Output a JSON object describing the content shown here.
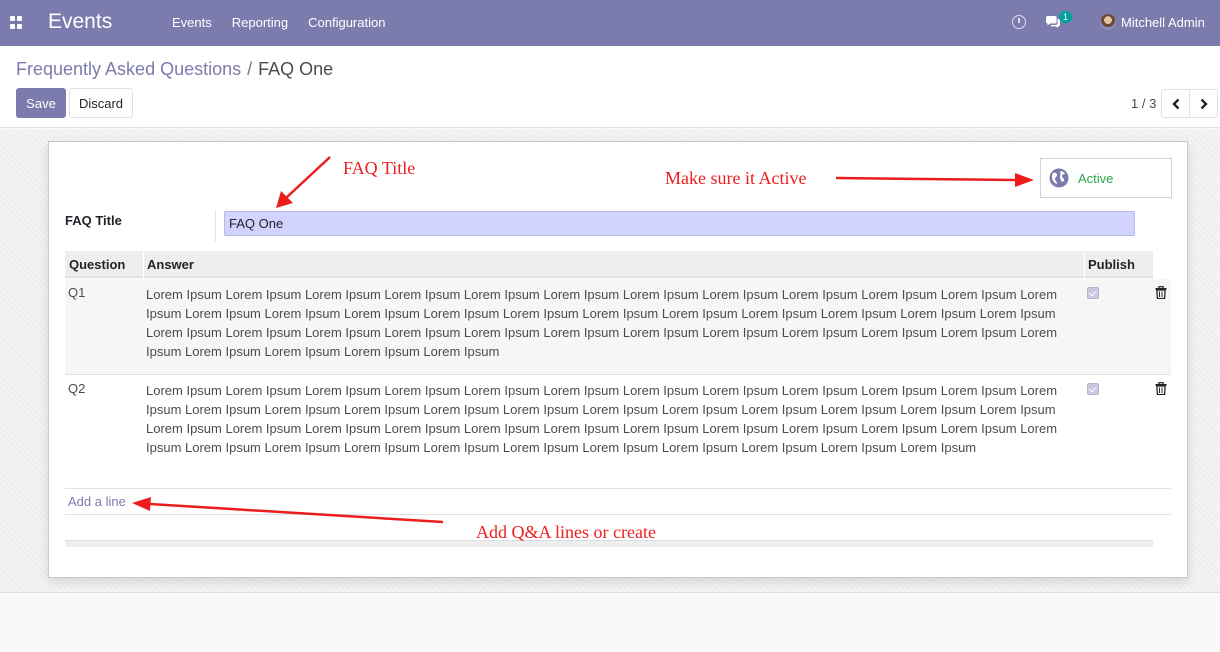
{
  "app": {
    "name": "Events",
    "menu": [
      "Events",
      "Reporting",
      "Configuration"
    ],
    "chat_count": "1",
    "user_name": "Mitchell Admin"
  },
  "breadcrumb": {
    "parent": "Frequently Asked Questions",
    "separator": "/",
    "current": "FAQ One"
  },
  "actions": {
    "save": "Save",
    "discard": "Discard"
  },
  "pager": {
    "value": "1 / 3"
  },
  "form": {
    "status": "Active",
    "title_label": "FAQ Title",
    "title_value": "FAQ One",
    "columns": [
      "Question",
      "Answer",
      "Publish"
    ],
    "rows": [
      {
        "question": "Q1",
        "answer": "Lorem Ipsum Lorem Ipsum Lorem Ipsum Lorem Ipsum Lorem Ipsum Lorem Ipsum Lorem Ipsum Lorem Ipsum Lorem Ipsum Lorem Ipsum Lorem Ipsum Lorem Ipsum Lorem Ipsum Lorem Ipsum Lorem Ipsum Lorem Ipsum Lorem Ipsum Lorem Ipsum Lorem Ipsum Lorem Ipsum Lorem Ipsum Lorem Ipsum Lorem Ipsum Lorem Ipsum Lorem Ipsum Lorem Ipsum Lorem Ipsum Lorem Ipsum Lorem Ipsum Lorem Ipsum Lorem Ipsum Lorem Ipsum Lorem Ipsum Lorem Ipsum Lorem Ipsum Lorem Ipsum Lorem Ipsum Lorem Ipsum Lorem Ipsum",
        "published": true
      },
      {
        "question": "Q2",
        "answer": "Lorem Ipsum Lorem Ipsum Lorem Ipsum Lorem Ipsum Lorem Ipsum Lorem Ipsum Lorem Ipsum Lorem Ipsum Lorem Ipsum Lorem Ipsum Lorem Ipsum Lorem Ipsum Lorem Ipsum Lorem Ipsum Lorem Ipsum Lorem Ipsum Lorem Ipsum Lorem Ipsum Lorem Ipsum Lorem Ipsum Lorem Ipsum Lorem Ipsum Lorem Ipsum Lorem Ipsum Lorem Ipsum Lorem Ipsum Lorem Ipsum Lorem Ipsum Lorem Ipsum Lorem Ipsum Lorem Ipsum Lorem Ipsum Lorem Ipsum Lorem Ipsum Lorem Ipsum Lorem Ipsum Lorem Ipsum Lorem Ipsum Lorem Ipsum Lorem Ipsum Lorem Ipsum Lorem Ipsum Lorem Ipsum Lorem Ipsum Lorem Ipsum",
        "published": true
      }
    ],
    "add_line": "Add a line"
  },
  "annotations": {
    "title_note": "FAQ Title",
    "active_note": "Make sure it Active",
    "lines_note": "Add Q&A lines or create"
  },
  "colors": {
    "brand": "#7c7bad",
    "active_green": "#28a745",
    "annotation_red": "#ee1d1d",
    "input_highlight": "#d2d2ff"
  },
  "icons": [
    "apps-icon",
    "clock-icon",
    "chat-icon",
    "avatar",
    "chevron-left-icon",
    "chevron-right-icon",
    "globe-icon",
    "trash-icon"
  ]
}
